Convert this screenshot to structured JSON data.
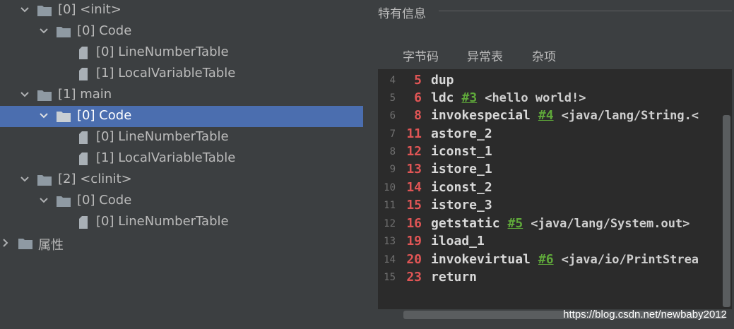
{
  "tree": {
    "rows": [
      {
        "label": "[0] <init>",
        "type": "folder",
        "expanded": true,
        "selected": false
      },
      {
        "label": "[0] Code",
        "type": "folder",
        "expanded": true,
        "selected": false
      },
      {
        "label": "[0] LineNumberTable",
        "type": "file",
        "selected": false
      },
      {
        "label": "[1] LocalVariableTable",
        "type": "file",
        "selected": false
      },
      {
        "label": "[1] main",
        "type": "folder",
        "expanded": true,
        "selected": false
      },
      {
        "label": "[0] Code",
        "type": "folder",
        "expanded": true,
        "selected": true
      },
      {
        "label": "[0] LineNumberTable",
        "type": "file",
        "selected": false
      },
      {
        "label": "[1] LocalVariableTable",
        "type": "file",
        "selected": false
      },
      {
        "label": "[2] <clinit>",
        "type": "folder",
        "expanded": true,
        "selected": false
      },
      {
        "label": "[0] Code",
        "type": "folder",
        "expanded": true,
        "selected": false
      },
      {
        "label": "[0] LineNumberTable",
        "type": "file",
        "selected": false
      },
      {
        "label": "属性",
        "type": "folder",
        "expanded": false,
        "selected": false
      }
    ]
  },
  "info": {
    "title": "特有信息"
  },
  "tabs": [
    {
      "label": "字节码",
      "active": true
    },
    {
      "label": "异常表",
      "active": false
    },
    {
      "label": "杂项",
      "active": false
    }
  ],
  "code": {
    "lines": [
      {
        "line": "4",
        "offset": "5",
        "instr": "dup",
        "ref": "",
        "comment": ""
      },
      {
        "line": "5",
        "offset": "6",
        "instr": "ldc",
        "ref": "#3",
        "comment": "<hello world!>"
      },
      {
        "line": "6",
        "offset": "8",
        "instr": "invokespecial",
        "ref": "#4",
        "comment": "<java/lang/String.<"
      },
      {
        "line": "7",
        "offset": "11",
        "instr": "astore_2",
        "ref": "",
        "comment": ""
      },
      {
        "line": "8",
        "offset": "12",
        "instr": "iconst_1",
        "ref": "",
        "comment": ""
      },
      {
        "line": "9",
        "offset": "13",
        "instr": "istore_1",
        "ref": "",
        "comment": ""
      },
      {
        "line": "10",
        "offset": "14",
        "instr": "iconst_2",
        "ref": "",
        "comment": ""
      },
      {
        "line": "11",
        "offset": "15",
        "instr": "istore_3",
        "ref": "",
        "comment": ""
      },
      {
        "line": "12",
        "offset": "16",
        "instr": "getstatic",
        "ref": "#5",
        "comment": "<java/lang/System.out>"
      },
      {
        "line": "13",
        "offset": "19",
        "instr": "iload_1",
        "ref": "",
        "comment": ""
      },
      {
        "line": "14",
        "offset": "20",
        "instr": "invokevirtual",
        "ref": "#6",
        "comment": "<java/io/PrintStrea"
      },
      {
        "line": "15",
        "offset": "23",
        "instr": "return",
        "ref": "",
        "comment": ""
      }
    ]
  },
  "watermark": "https://blog.csdn.net/newbaby2012",
  "colors": {
    "background": "#3c3f41",
    "selection": "#4b6eaf",
    "code_background": "#2b2b2b",
    "offset": "#e05555",
    "reference": "#5fa83a"
  }
}
